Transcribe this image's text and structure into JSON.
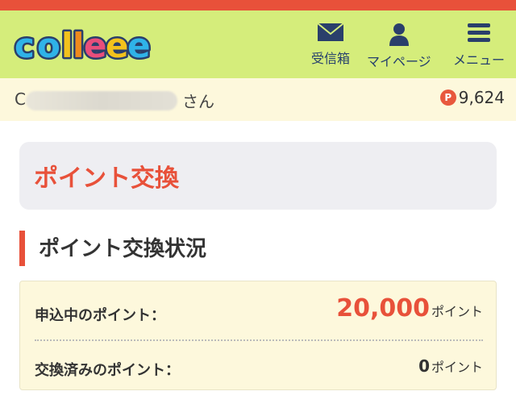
{
  "header": {
    "logo_text": "colleee",
    "nav": [
      {
        "label": "受信箱",
        "icon": "envelope-icon"
      },
      {
        "label": "マイページ",
        "icon": "person-icon"
      },
      {
        "label": "メニュー",
        "icon": "hamburger-menu-icon"
      }
    ]
  },
  "user": {
    "name_initial": "C",
    "honorific": "さん",
    "points_badge": "P",
    "points": "9,624"
  },
  "page_title": "ポイント交換",
  "section_title": "ポイント交換状況",
  "status": {
    "pending_label": "申込中のポイント：",
    "pending_value": "20,000",
    "pending_unit": "ポイント",
    "done_label": "交換済みのポイント：",
    "done_value": "0",
    "done_unit": "ポイント"
  },
  "colors": {
    "accent": "#e8513a",
    "header_bg": "#d5ed7b",
    "panel_bg": "#fdf8dc"
  }
}
